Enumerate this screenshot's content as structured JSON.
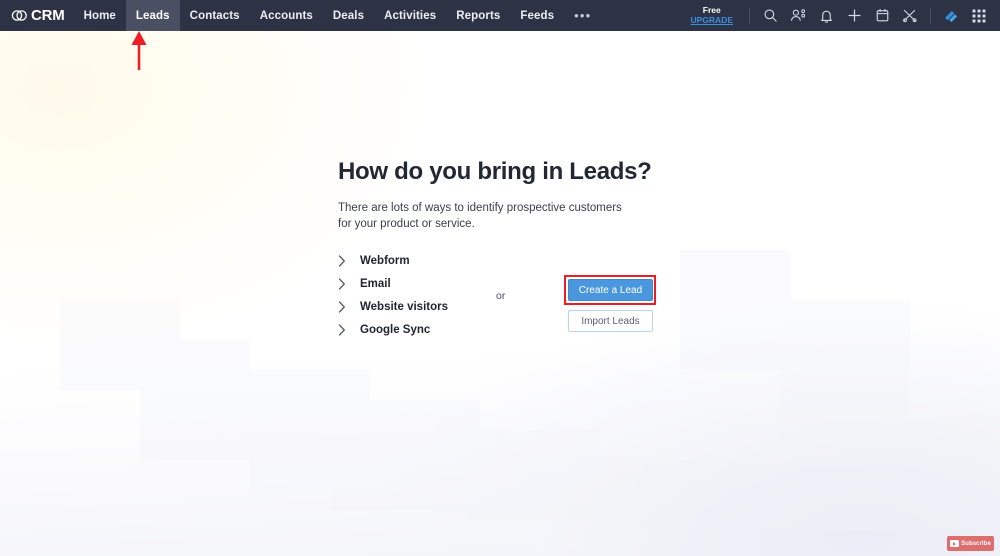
{
  "app": {
    "logo_text": "CRM",
    "logo_icon": "zoho-circles-icon"
  },
  "navbar": {
    "tabs": [
      {
        "label": "Home",
        "active": false
      },
      {
        "label": "Leads",
        "active": true
      },
      {
        "label": "Contacts",
        "active": false
      },
      {
        "label": "Accounts",
        "active": false
      },
      {
        "label": "Deals",
        "active": false
      },
      {
        "label": "Activities",
        "active": false
      },
      {
        "label": "Reports",
        "active": false
      },
      {
        "label": "Feeds",
        "active": false
      }
    ],
    "more_label": "•••",
    "upgrade": {
      "plan_label": "Free",
      "link_label": "UPGRADE"
    },
    "icons": [
      {
        "name": "search-icon"
      },
      {
        "name": "contacts-icon"
      },
      {
        "name": "notifications-bell-icon"
      },
      {
        "name": "add-plus-icon"
      },
      {
        "name": "calendar-icon"
      },
      {
        "name": "tools-icon"
      },
      {
        "name": "zia-icon"
      },
      {
        "name": "apps-grid-icon"
      }
    ]
  },
  "main": {
    "title": "How do you bring in Leads?",
    "subtitle": "There are lots of ways to identify prospective customers for your product or service.",
    "options": [
      {
        "label": "Webform",
        "icon": "chevron-right-icon"
      },
      {
        "label": "Email",
        "icon": "chevron-right-icon"
      },
      {
        "label": "Website visitors",
        "icon": "chevron-right-icon"
      },
      {
        "label": "Google Sync",
        "icon": "chevron-right-icon"
      }
    ],
    "separator_label": "or",
    "primary_button": "Create a Lead",
    "secondary_button": "Import Leads"
  },
  "annotations": {
    "arrow_target": "Leads",
    "arrow_color": "#ee1c25",
    "highlight_target": "Create a Lead",
    "highlight_color": "#ee1c25"
  },
  "overlay": {
    "subscribe_label": "Subscribe"
  },
  "colors": {
    "navbar_bg": "#2e3245",
    "navbar_active_tab": "#4a4f63",
    "primary_blue": "#4a97dd",
    "link_blue": "#3b8fe0",
    "annotation_red": "#ee1c25",
    "page_bg": "#ffffff"
  }
}
